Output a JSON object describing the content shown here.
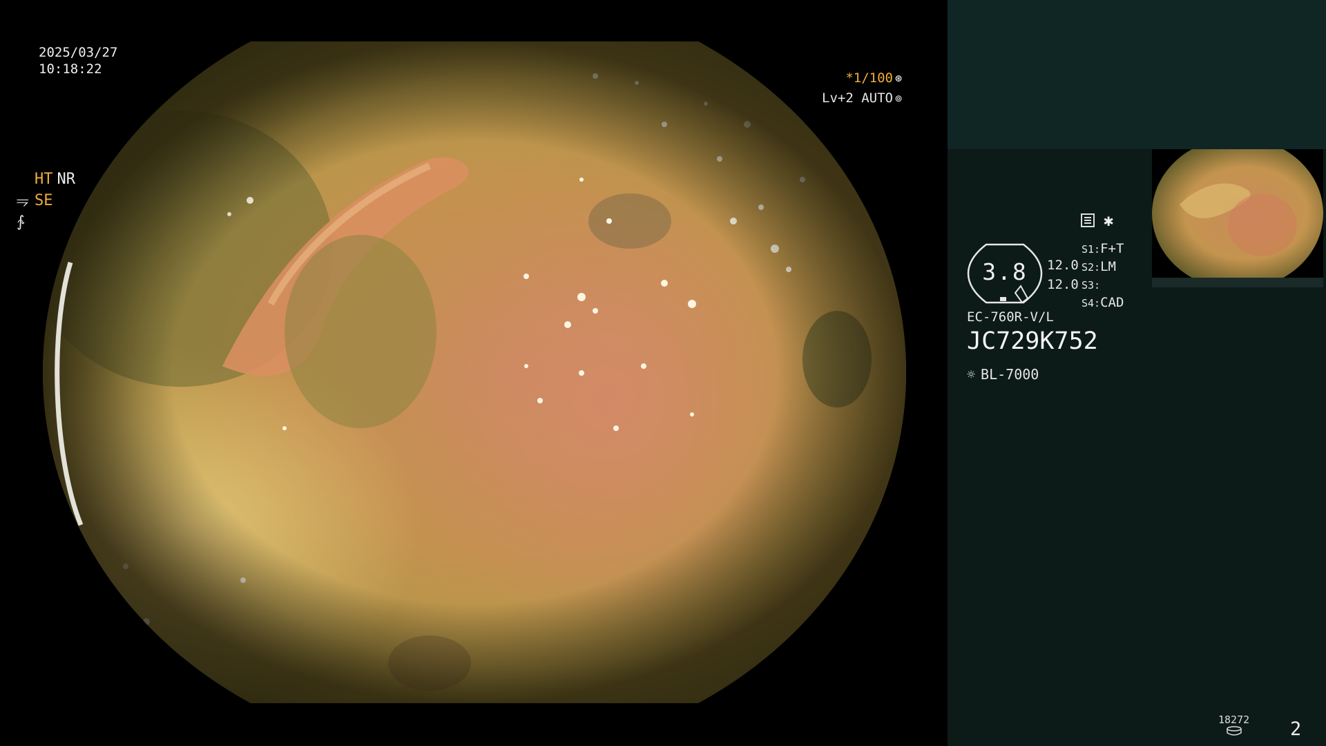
{
  "timestamp": {
    "date": "2025/03/27",
    "time": "10:18:22"
  },
  "top_right": {
    "shutter": "*1/100",
    "level": "Lv+2 AUTO"
  },
  "modes": {
    "ht": "HT",
    "nr": "NR",
    "se": "SE"
  },
  "meter": {
    "value": "3.8",
    "line1": "12.0",
    "line2": "12.0"
  },
  "switches": [
    {
      "key": "S1:",
      "value": "F+T"
    },
    {
      "key": "S2:",
      "value": "LM"
    },
    {
      "key": "S3:",
      "value": ""
    },
    {
      "key": "S4:",
      "value": "CAD"
    }
  ],
  "scope": {
    "model": "EC-760R-V/L",
    "serial": "JC729K752"
  },
  "light_source": "BL-7000",
  "counter": "18272",
  "page_number": "2",
  "colors": {
    "accent": "#f0ad3a",
    "panel": "#0c1a18",
    "panel_top": "#0f2624"
  }
}
